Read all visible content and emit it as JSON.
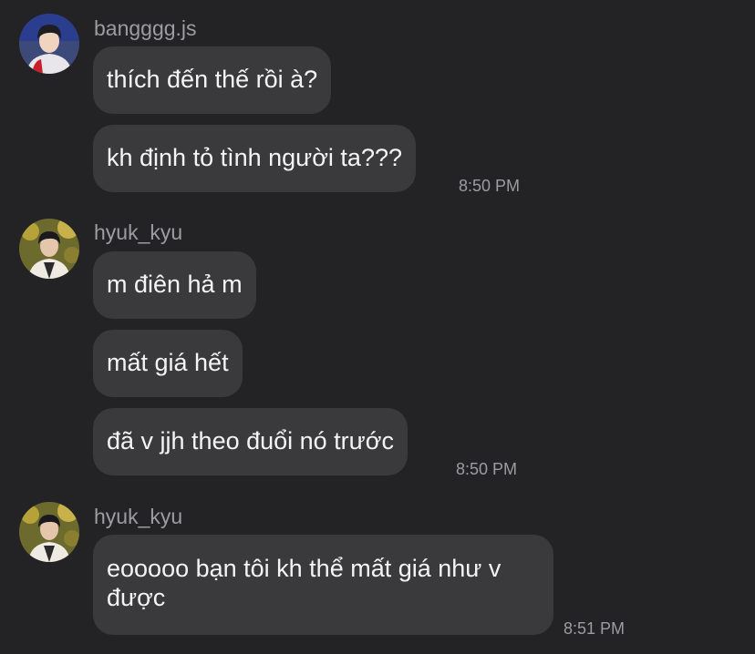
{
  "colors": {
    "background": "#232325",
    "bubble": "#3a3a3c",
    "message_text": "#f4f4f6",
    "meta_text": "#9c9ca1"
  },
  "groups": [
    {
      "username": "bangggg.js",
      "avatar_icon": "user-avatar-photo",
      "messages": [
        "thích đến thế rồi à?",
        "kh định tỏ tình người ta???"
      ],
      "time": "8:50 PM"
    },
    {
      "username": "hyuk_kyu",
      "avatar_icon": "user-avatar-photo",
      "messages": [
        "m điên hả m",
        "mất giá hết",
        "đã v jjh theo đuổi nó trước"
      ],
      "time": "8:50 PM"
    },
    {
      "username": "hyuk_kyu",
      "avatar_icon": "user-avatar-photo",
      "messages": [
        "eooooo bạn tôi kh thể mất giá như v được"
      ],
      "time": "8:51 PM"
    }
  ]
}
